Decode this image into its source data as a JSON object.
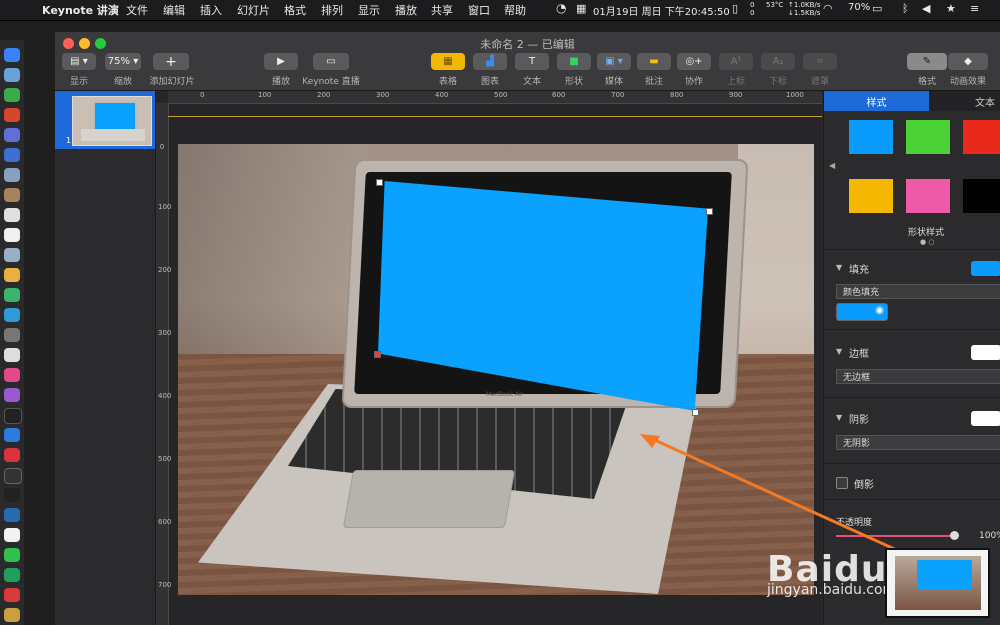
{
  "menubar": {
    "app_name": "Keynote 讲演",
    "menus": [
      "文件",
      "编辑",
      "插入",
      "幻灯片",
      "格式",
      "排列",
      "显示",
      "播放",
      "共享",
      "窗口",
      "帮助"
    ],
    "temp": "53°C",
    "net_up": "↑1.0KB/s",
    "net_down": "↓1.5KB/s",
    "net_counts": [
      "0",
      "0"
    ],
    "datetime": "01月19日 周日 下午20:45:50",
    "battery": "70%"
  },
  "window": {
    "title": "未命名 2 — 已编辑"
  },
  "toolbar": {
    "view_label": "显示",
    "zoom_value": "75%",
    "zoom_label": "缩放",
    "add_slide_label": "添加幻灯片",
    "play_label": "播放",
    "live_label": "Keynote 直播",
    "table_label": "表格",
    "chart_label": "图表",
    "text_label": "文本",
    "shape_label": "形状",
    "media_label": "媒体",
    "comment_label": "批注",
    "collab_label": "协作",
    "superscript_label": "上标",
    "subscript_label": "下标",
    "mask_label": "遮罩",
    "format_label": "格式",
    "animate_label": "动画效果"
  },
  "navigator": {
    "slide_number": "1"
  },
  "ruler": {
    "top_ticks": [
      "0",
      "100",
      "200",
      "300",
      "400",
      "500",
      "600",
      "700",
      "800",
      "900",
      "1000"
    ],
    "left_ticks": [
      "0",
      "100",
      "200",
      "300",
      "400",
      "500",
      "600",
      "700"
    ]
  },
  "slide": {
    "brand_text": "MacBook Air"
  },
  "inspector": {
    "tab_style": "样式",
    "tab_text": "文本",
    "swatch_colors": [
      "#0a9bff",
      "#4cd137",
      "#e8291c",
      "#f5b700",
      "#ef5aa8",
      "#000000"
    ],
    "shape_styles_label": "形状样式",
    "fill_label": "填充",
    "fill_type": "颜色填充",
    "border_label": "边框",
    "border_value": "无边框",
    "shadow_label": "阴影",
    "shadow_value": "无阴影",
    "reflection_label": "倒影",
    "opacity_label": "不透明度",
    "opacity_value": "100%"
  },
  "watermark": {
    "brand": "Baidu 经验",
    "url": "jingyan.baidu.com"
  },
  "colors": {
    "accent": "#1e6ad8",
    "screen_fill": "#0aa1ff",
    "annotation_arrow": "#f47920"
  }
}
